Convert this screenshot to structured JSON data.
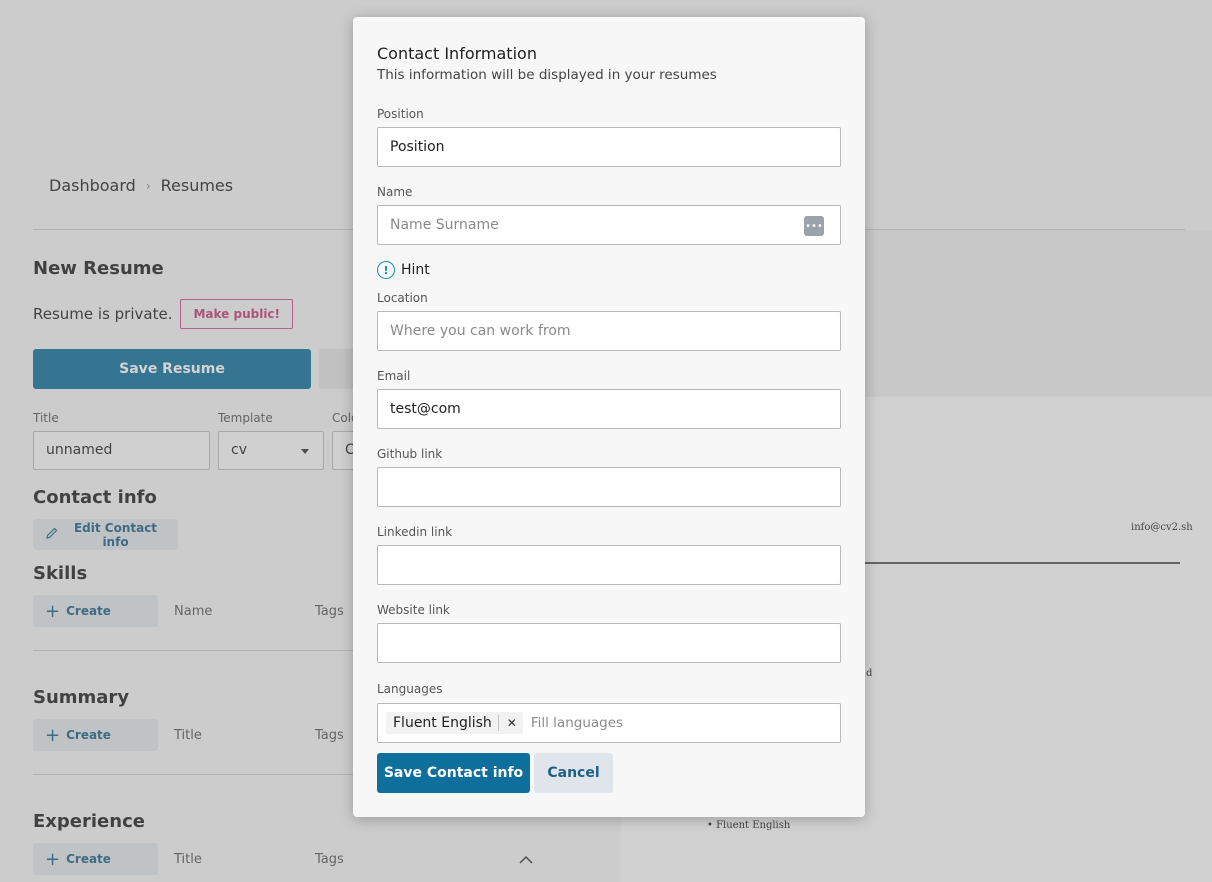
{
  "breadcrumb": {
    "items": [
      "Dashboard",
      "Resumes"
    ]
  },
  "resume": {
    "heading": "New Resume",
    "privacy_text": "Resume is private.",
    "make_public_label": "Make public!",
    "save_label": "Save Resume",
    "title_label": "Title",
    "title_value": "unnamed",
    "template_label": "Template",
    "template_value": "cv",
    "color_label": "Colo",
    "color_value": "C"
  },
  "sections": {
    "contact": {
      "title": "Contact info",
      "edit_label": "Edit Contact info"
    },
    "skills": {
      "title": "Skills",
      "create_label": "Create",
      "col1": "Name",
      "col2": "Tags"
    },
    "summary": {
      "title": "Summary",
      "create_label": "Create",
      "col1": "Title",
      "col2": "Tags"
    },
    "experience": {
      "title": "Experience",
      "create_label": "Create",
      "col1": "Title",
      "col2": "Tags"
    }
  },
  "preview": {
    "email": "info@cv2.sh",
    "fragment": "d",
    "language_item": "Fluent English"
  },
  "modal": {
    "title": "Contact Information",
    "subtitle": "This information will be displayed in your resumes",
    "position": {
      "label": "Position",
      "value": "Position"
    },
    "name": {
      "label": "Name",
      "placeholder": "Name Surname"
    },
    "hint_label": "Hint",
    "location": {
      "label": "Location",
      "placeholder": "Where you can work from"
    },
    "email": {
      "label": "Email",
      "value": "test@com"
    },
    "github": {
      "label": "Github link",
      "value": ""
    },
    "linkedin": {
      "label": "Linkedin link",
      "value": ""
    },
    "website": {
      "label": "Website link",
      "value": ""
    },
    "languages": {
      "label": "Languages",
      "tags": [
        "Fluent English"
      ],
      "placeholder": "Fill languages"
    },
    "save_label": "Save Contact info",
    "cancel_label": "Cancel"
  },
  "colors": {
    "primary": "#0f6f9c",
    "accent_pink": "#c23d79",
    "hint": "#1a8bb0"
  }
}
